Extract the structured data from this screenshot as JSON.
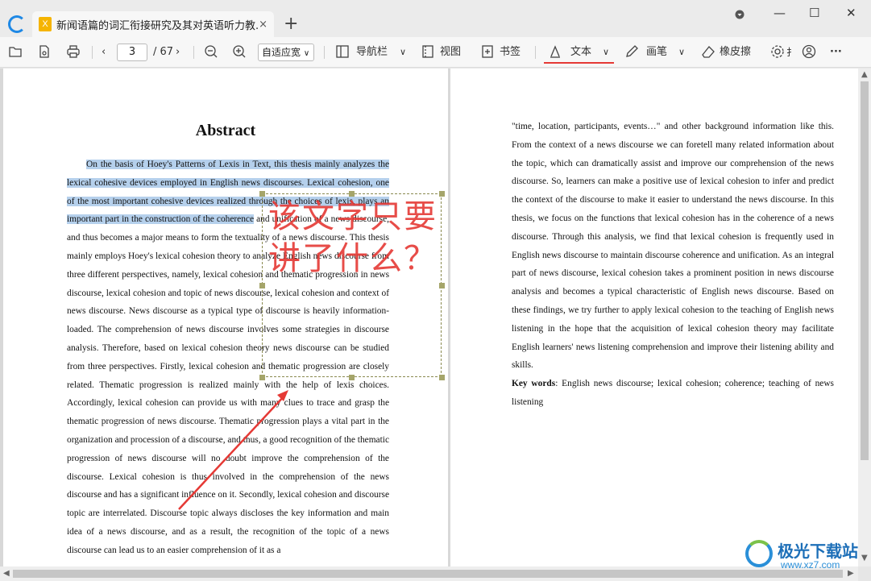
{
  "tab": {
    "title": "新闻语篇的词汇衔接研究及其对英语听力教...",
    "doc_icon": "X",
    "close": "×",
    "new": "+"
  },
  "window": {
    "minimize": "—",
    "maximize": "☐",
    "close": "✕"
  },
  "toolbar": {
    "page_current": "3",
    "page_total": "/ 67",
    "zoom": "自适应宽",
    "nav": "导航栏",
    "view": "视图",
    "bookmark": "书签",
    "text": "文本",
    "pen": "画笔",
    "eraser": "橡皮擦",
    "more": "···",
    "truncated": "扌"
  },
  "annotation": {
    "text": "该文字只要讲了什么？"
  },
  "left_page": {
    "title": "Abstract",
    "paragraphs": [
      "On the basis of Hoey's Patterns of Lexis in Text, this thesis mainly analyzes the lexical cohesive devices employed in English news discourses. Lexical cohesion, one of the most important cohesive devices realized through the choices of lexis, plays an important part in the construction of the coherence and unification of a news discourse, and thus becomes a major means to form the textuality of a news discourse. This thesis mainly employs Hoey's lexical cohesion theory to analyze English news discourse from three different perspectives, namely, lexical cohesion and thematic progression in news discourse, lexical cohesion and topic of news discourse, lexical cohesion and context of news discourse. News discourse as a typical type of discourse is heavily information-loaded. The comprehension of news discourse involves some strategies in discourse analysis. Therefore, based on lexical cohesion theory news discourse can be studied from three perspectives. Firstly, lexical cohesion and thematic progression are closely related. Thematic progression is realized mainly with the help of lexis choices. Accordingly, lexical cohesion can provide us with many clues to trace and grasp the thematic progression of news discourse. Thematic progression plays a vital part in the organization and procession of a discourse, and thus, a good recognition of the thematic progression of news discourse will no doubt improve the comprehension of the discourse. Lexical cohesion is thus involved in the comprehension of the news discourse and has a significant influence on it. Secondly, lexical cohesion and discourse topic are interrelated. Discourse topic always discloses the key information and main idea of a news discourse, and as a result, the recognition of the topic of a news discourse can lead us to an easier comprehension of it as a"
    ],
    "highlight": "On the basis of Hoey's Patterns of Lexis in Text, this thesis mainly analyzes the lexical cohesive devices employed in English news discourses. Lexical cohesion, one of the most important cohesive devices realized through the choices of lexis, plays an important part in the construction of the coherence",
    "rest": " and unification of a news discourse, and thus becomes a major means to form the textuality of a news discourse. This thesis mainly employs Hoey's lexical cohesion theory to analyze English news discourse from three different perspectives, namely, lexical cohesion and thematic progression in news discourse, lexical cohesion and topic of news discourse, lexical cohesion and context of news discourse. News discourse as a typical type of discourse is heavily information-loaded. The comprehension of news discourse involves some strategies in discourse analysis. Therefore, based on lexical cohesion theory news discourse can be studied from three perspectives. Firstly, lexical cohesion and thematic progression are closely related. Thematic progression is realized mainly with the help of lexis choices. Accordingly, lexical cohesion can provide us with many clues to trace and grasp the thematic progression of news discourse. Thematic progression plays a vital part in the organization and procession of a discourse, and thus, a good recognition of the thematic progression of news discourse will no doubt improve the comprehension of the discourse. Lexical cohesion is thus involved in the comprehension of the news discourse and has a significant influence on it. Secondly, lexical cohesion and discourse topic are interrelated. Discourse topic always discloses the key information and main idea of a news discourse, and as a result, the recognition of the topic of a news discourse can lead us to an easier comprehension of it as a"
  },
  "right_page": {
    "paragraph": "\"time, location, participants, events…\" and other background information like this. From the context of a news discourse we can foretell many related information about the topic, which can dramatically assist and improve our comprehension of the news discourse. So, learners can make a positive use of lexical cohesion to infer and predict the context of the discourse to make it easier to understand the news discourse. In this thesis, we focus on the functions that lexical cohesion has in the coherence of a news discourse. Through this analysis, we find that lexical cohesion is frequently used in English news discourse to maintain discourse coherence and unification. As an integral part of news discourse, lexical cohesion takes a prominent position in news discourse analysis and becomes a typical characteristic of English news discourse. Based on these findings, we try further to apply lexical cohesion to the teaching of English news listening in the hope that the acquisition of lexical cohesion theory may facilitate English learners' news listening comprehension and improve their listening ability and skills.",
    "keywords_label": "Key words",
    "keywords_text": ": English news discourse; lexical cohesion; coherence; teaching of news listening"
  },
  "watermark": {
    "title": "极光下载站",
    "url": "www.xz7.com"
  },
  "colors": {
    "annotation_red": "#e53935",
    "highlight_blue": "#78aadc",
    "accent_underline": "#e53935"
  }
}
